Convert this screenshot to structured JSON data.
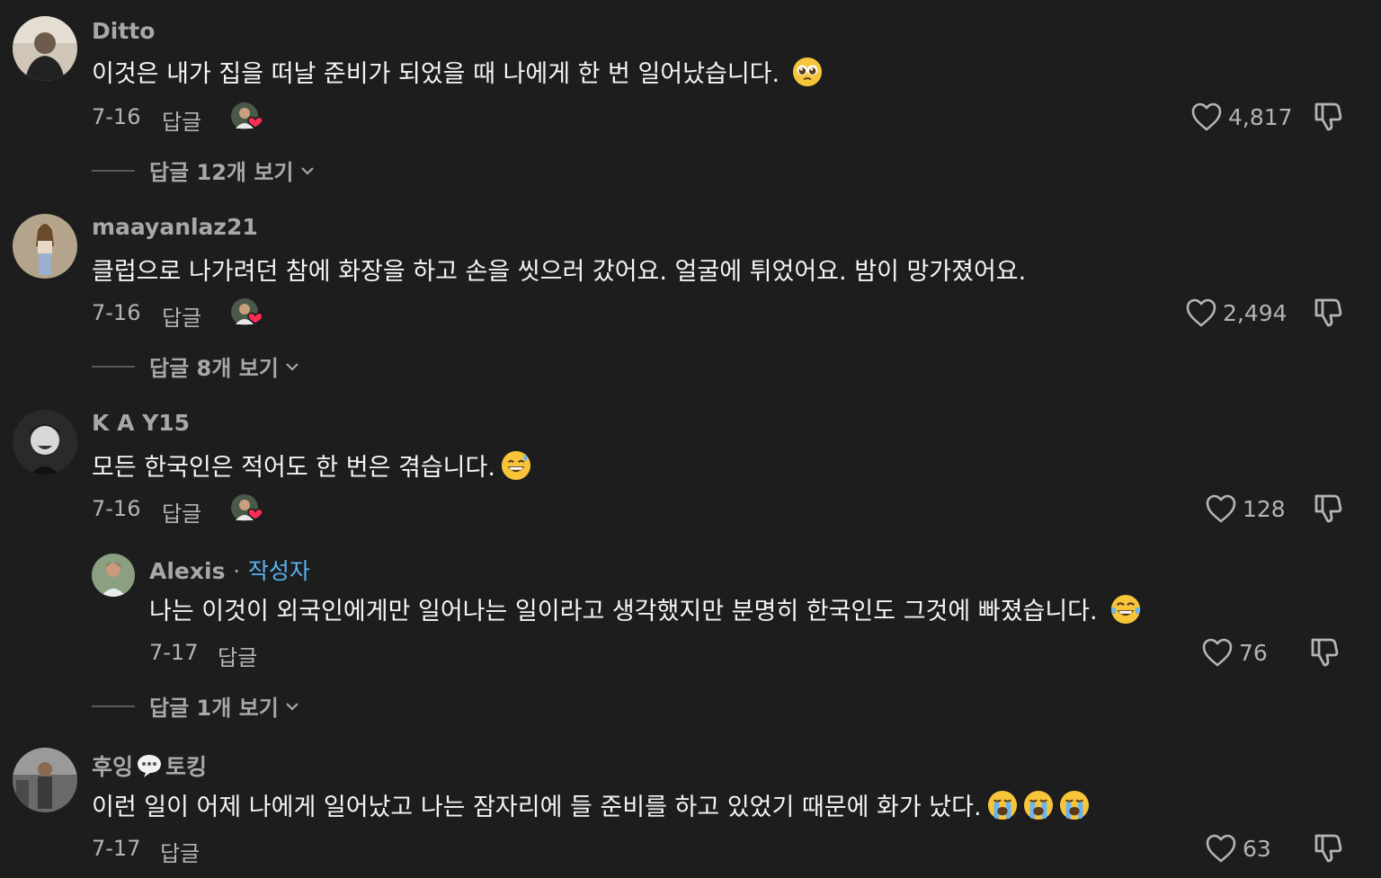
{
  "comments": [
    {
      "username": "Ditto",
      "text": "이것은 내가 집을 떠날 준비가 되었을 때 나에게 한 번 일어났습니다.",
      "emoji": "pleading-face",
      "date": "7-16",
      "reply_label": "답글",
      "likes": "4,817",
      "view_replies": "답글 12개 보기"
    },
    {
      "username": "maayanlaz21",
      "text": "클럽으로 나가려던 참에 화장을 하고 손을 씻으러 갔어요. 얼굴에 튀었어요. 밤이 망가졌어요.",
      "date": "7-16",
      "reply_label": "답글",
      "likes": "2,494",
      "view_replies": "답글 8개 보기"
    },
    {
      "username": "K A Y15",
      "text": "모든 한국인은 적어도 한 번은 겪습니다.",
      "emoji": "grinning-sweat-face",
      "date": "7-16",
      "reply_label": "답글",
      "likes": "128",
      "reply": {
        "username": "Alexis",
        "separator": "·",
        "author_tag": "작성자",
        "text": "나는 이것이 외국인에게만 일어나는 일이라고 생각했지만 분명히 한국인도 그것에 빠졌습니다.",
        "emoji": "tears-of-joy-face",
        "date": "7-17",
        "reply_label": "답글",
        "likes": "76"
      },
      "view_replies": "답글 1개 보기"
    },
    {
      "username_part1": "후잉",
      "username_part2": "토킹",
      "username_emoji": "speech-bubble",
      "text": "이런 일이 어제 나에게 일어났고 나는 잠자리에 들 준비를 하고 있었기 때문에 화가 났다.",
      "emojis": [
        "loudly-crying-face",
        "loudly-crying-face",
        "loudly-crying-face"
      ],
      "date": "7-17",
      "reply_label": "답글",
      "likes": "63"
    }
  ],
  "colors": {
    "background": "#1d1d1d",
    "username": "#a8a8a8",
    "author_tag": "#58b4f0",
    "like_heart_badge": "#fe2c55"
  }
}
